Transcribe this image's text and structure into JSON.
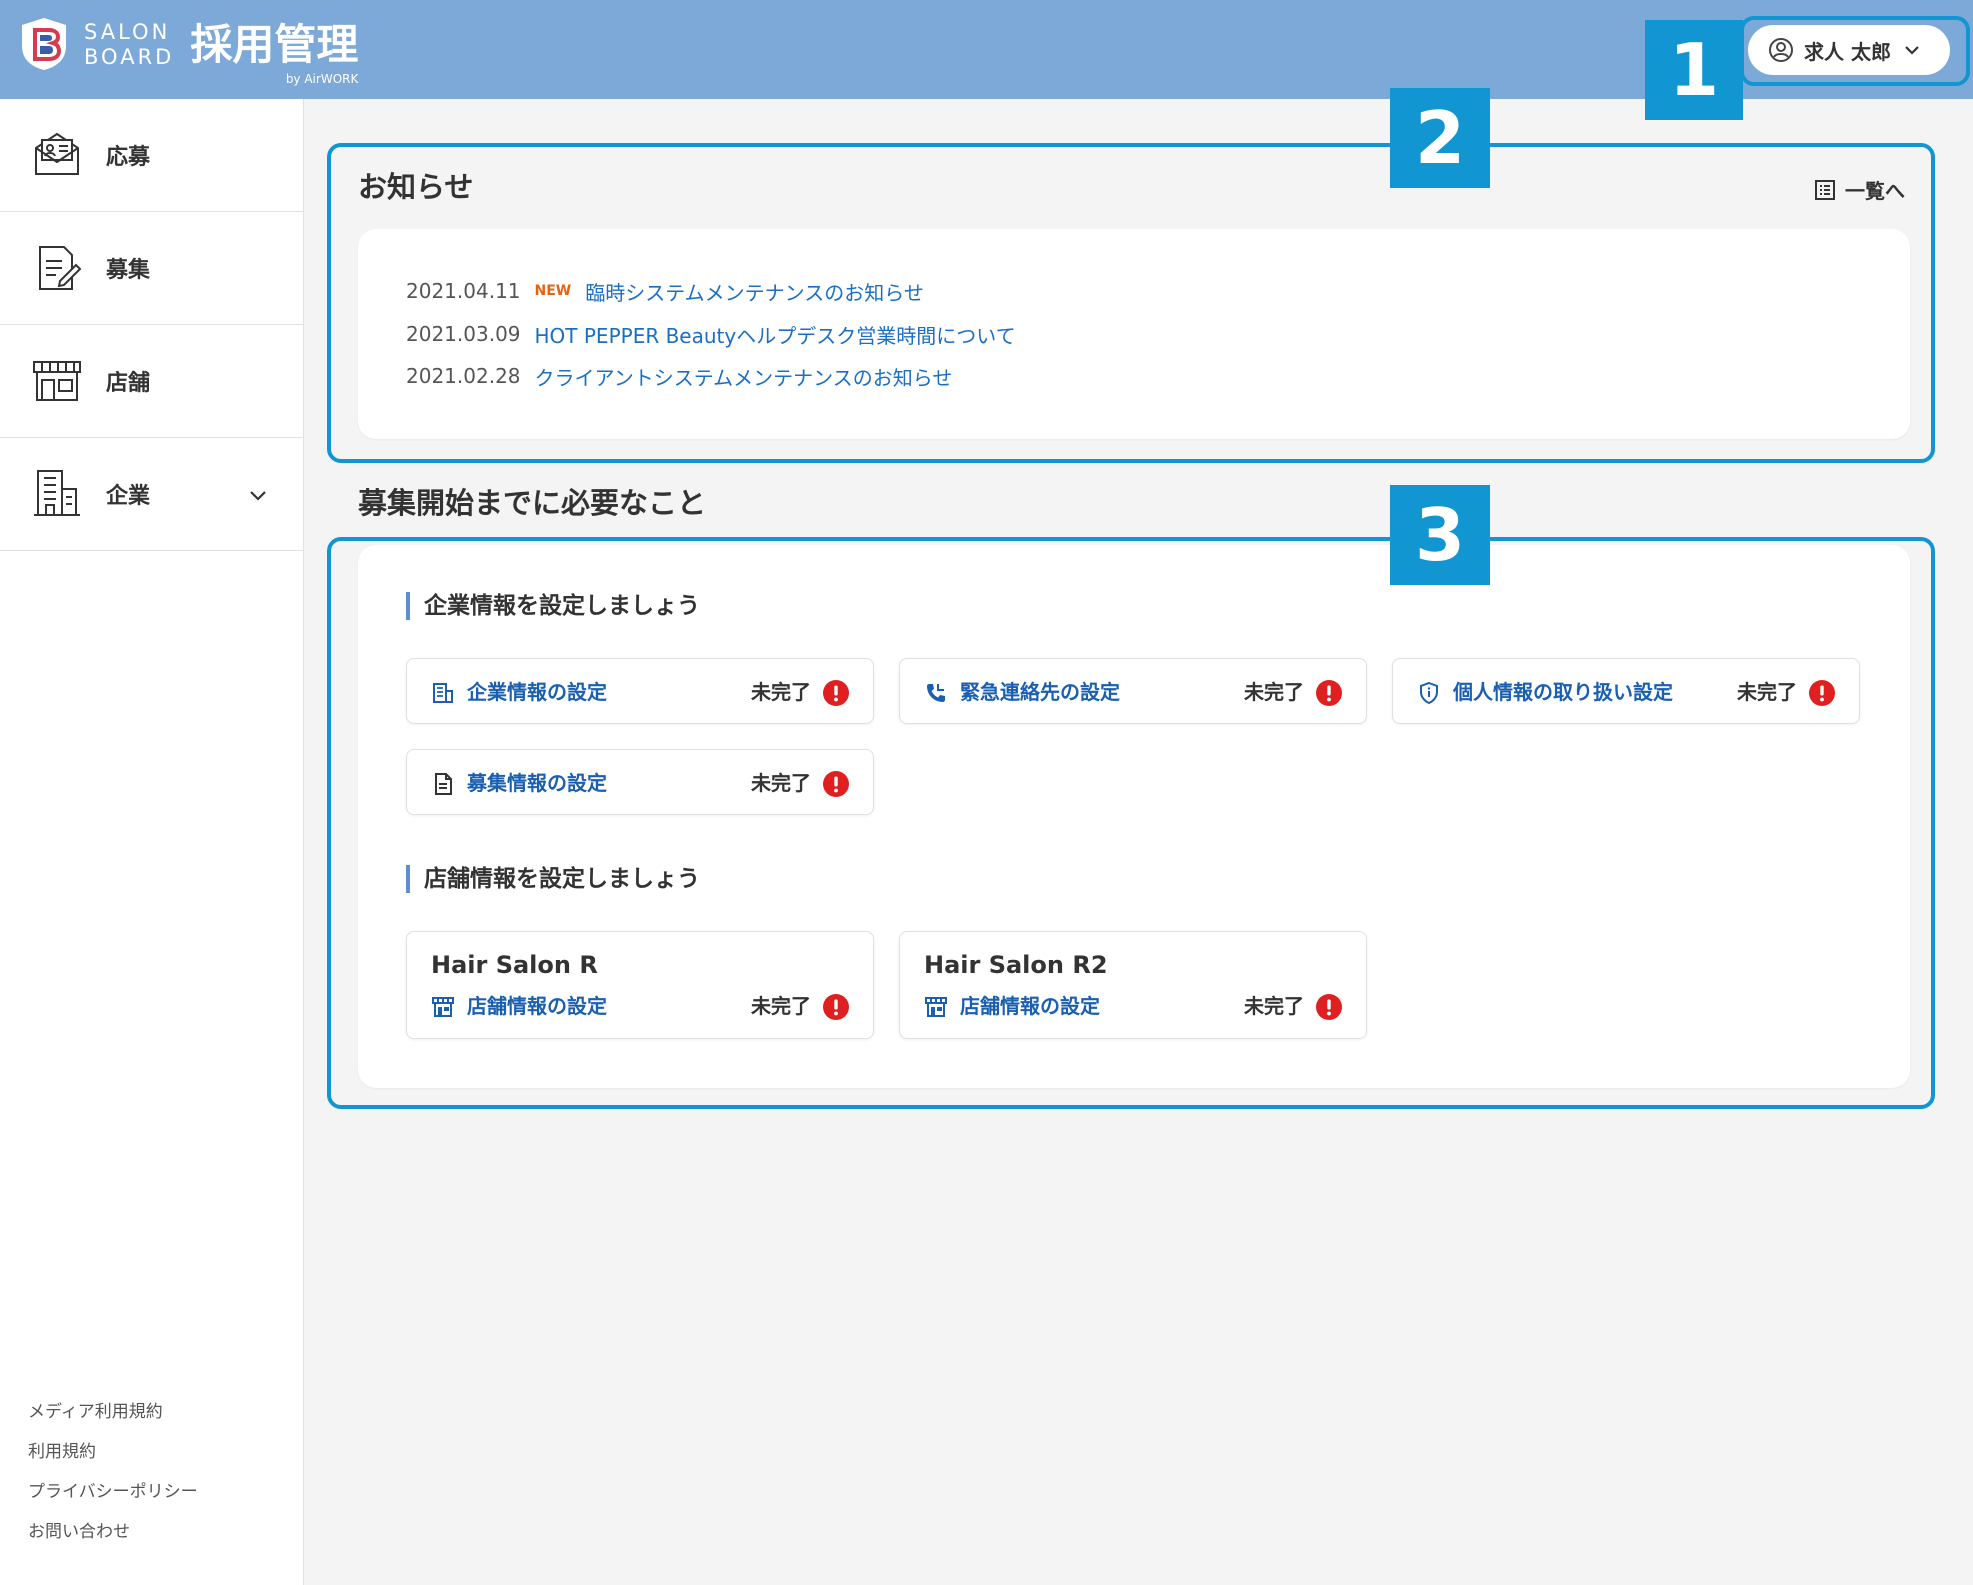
{
  "header": {
    "brand_line1": "SALON",
    "brand_line2": "BOARD",
    "product": "採用管理",
    "by": "by AirWORK",
    "user_name": "求人 太郎"
  },
  "sidebar": {
    "items": [
      {
        "label": "応募",
        "icon": "application-icon"
      },
      {
        "label": "募集",
        "icon": "recruitment-icon"
      },
      {
        "label": "店舗",
        "icon": "store-icon"
      },
      {
        "label": "企業",
        "icon": "company-building-icon"
      }
    ],
    "footer_links": [
      "メディア利用規約",
      "利用規約",
      "プライバシーポリシー",
      "お問い合わせ"
    ]
  },
  "news": {
    "title": "お知らせ",
    "list_link": "一覧へ",
    "items": [
      {
        "date": "2021.04.11",
        "badge": "NEW",
        "title": "臨時システムメンテナンスのお知らせ"
      },
      {
        "date": "2021.03.09",
        "title": "HOT PEPPER Beautyヘルプデスク営業時間について"
      },
      {
        "date": "2021.02.28",
        "title": "クライアントシステムメンテナンスのお知らせ"
      }
    ]
  },
  "setup": {
    "title": "募集開始までに必要なこと",
    "company_heading": "企業情報を設定しましょう",
    "company_tasks": [
      {
        "label": "企業情報の設定",
        "status": "未完了",
        "icon": "building-icon"
      },
      {
        "label": "緊急連絡先の設定",
        "status": "未完了",
        "icon": "phone-icon"
      },
      {
        "label": "個人情報の取り扱い設定",
        "status": "未完了",
        "icon": "shield-icon"
      },
      {
        "label": "募集情報の設定",
        "status": "未完了",
        "icon": "document-icon"
      }
    ],
    "store_heading": "店舗情報を設定しましょう",
    "stores": [
      {
        "name": "Hair Salon R",
        "label": "店舗情報の設定",
        "status": "未完了"
      },
      {
        "name": "Hair Salon R2",
        "label": "店舗情報の設定",
        "status": "未完了"
      }
    ]
  },
  "callouts": [
    "1",
    "2",
    "3"
  ],
  "colors": {
    "header": "#7da9d8",
    "callout": "#1196d1",
    "link": "#1a6fc4",
    "task_label": "#1a5fb0",
    "alert": "#e02020",
    "new_badge": "#e8620e"
  }
}
